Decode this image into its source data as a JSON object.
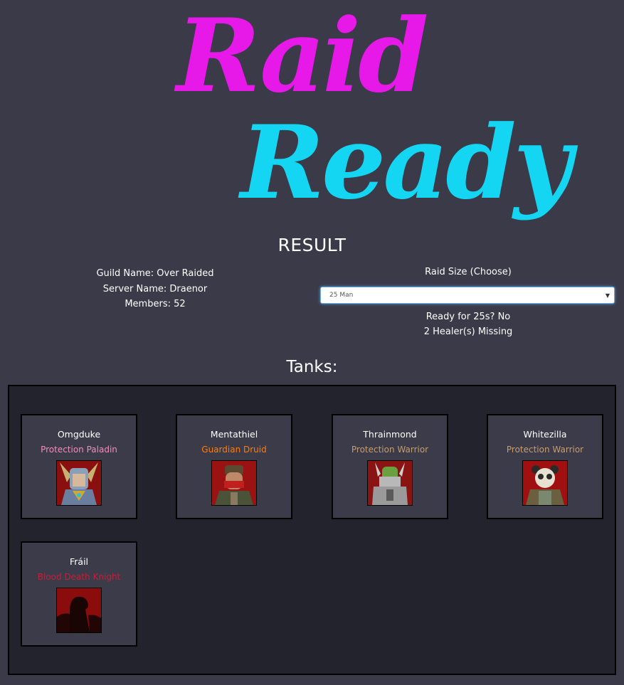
{
  "logo": {
    "line1": "Raid",
    "line2": "Ready",
    "color1": "#e619e8",
    "color2": "#14d6f2"
  },
  "result": {
    "title": "RESULT"
  },
  "guild": {
    "name_line": "Guild Name: Over Raided",
    "server_line": "Server Name: Draenor",
    "members_line": "Members: 52"
  },
  "raid": {
    "size_label": "Raid Size (Choose)",
    "selected": "25 Man",
    "ready_line": "Ready for 25s? No",
    "missing_line": "2 Healer(s) Missing"
  },
  "tanks": {
    "title": "Tanks:",
    "members": [
      {
        "name": "Omgduke",
        "spec": "Protection Paladin",
        "spec_color": "#f58cba",
        "portrait_icon": "paladin-portrait-icon"
      },
      {
        "name": "Mentathiel",
        "spec": "Guardian Druid",
        "spec_color": "#ff7d0a",
        "portrait_icon": "druid-portrait-icon"
      },
      {
        "name": "Thrainmond",
        "spec": "Protection Warrior",
        "spec_color": "#c79c6e",
        "portrait_icon": "warrior-portrait-icon"
      },
      {
        "name": "Whitezilla",
        "spec": "Protection Warrior",
        "spec_color": "#c79c6e",
        "portrait_icon": "pandaren-warrior-portrait-icon"
      },
      {
        "name": "Fráil",
        "spec": "Blood Death Knight",
        "spec_color": "#c41f3b",
        "portrait_icon": "death-knight-portrait-icon"
      }
    ]
  }
}
